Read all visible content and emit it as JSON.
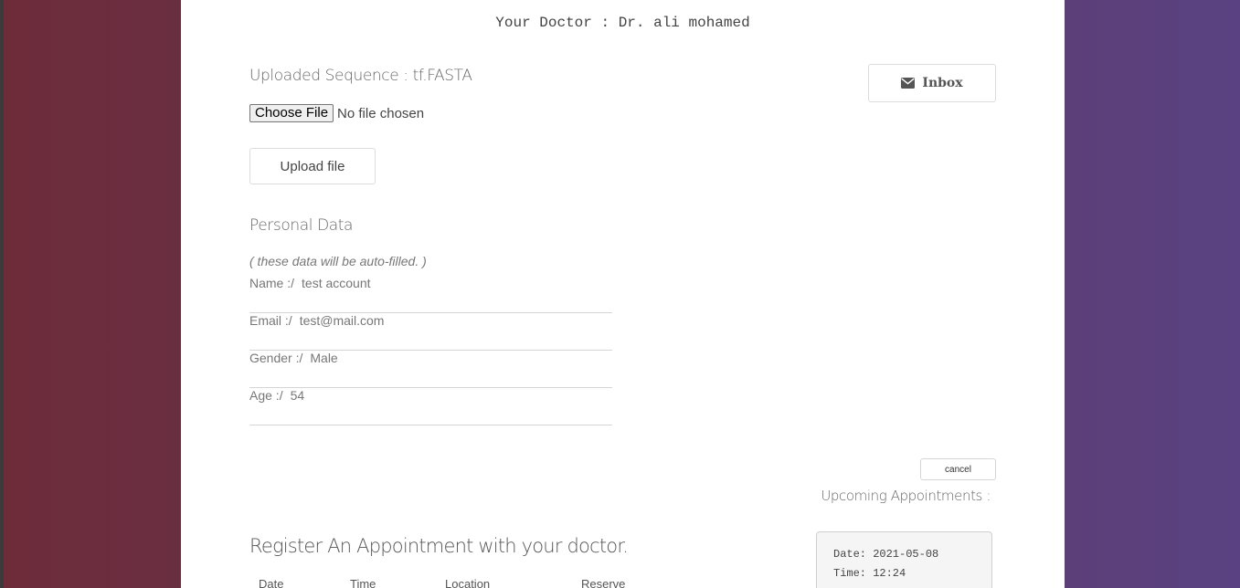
{
  "header": {
    "doctor_line": "Your Doctor : Dr. ali mohamed"
  },
  "sequence": {
    "title": "Uploaded Sequence : tf.FASTA",
    "choose_file_label": "Choose File",
    "file_status": "No file chosen",
    "upload_label": "Upload file"
  },
  "inbox": {
    "label": "Inbox",
    "icon": "envelope-icon"
  },
  "personal": {
    "title": "Personal Data",
    "note": "( these data will be auto-filled. )",
    "fields": [
      {
        "label": "Name :/",
        "value": "test account"
      },
      {
        "label": "Email :/",
        "value": "test@mail.com"
      },
      {
        "label": "Gender :/",
        "value": "Male"
      },
      {
        "label": "Age :/",
        "value": "54"
      }
    ]
  },
  "appointments": {
    "cancel_label": "cancel",
    "upcoming_label": "Upcoming Appointments :",
    "register_title": "Register An Appointment with your doctor.",
    "columns": [
      "Date",
      "Time",
      "Location",
      "Reserve"
    ],
    "upcoming": {
      "date_line": "Date: 2021-05-08",
      "time_line": "Time: 12:24"
    }
  }
}
